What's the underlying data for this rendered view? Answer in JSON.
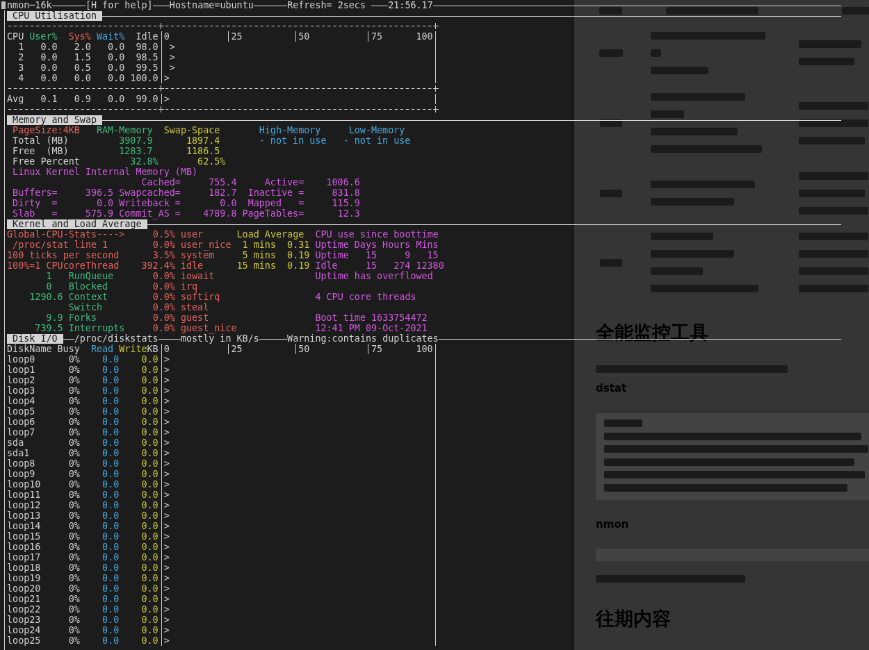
{
  "title_bar": {
    "items": [
      "nmon─16k",
      "[H for help]",
      "Hostname=ubuntu",
      "Refresh= 2secs",
      "21:56.17"
    ]
  },
  "cpu": {
    "title": "CPU Utilisation",
    "columns": [
      {
        "label": "CPU",
        "color": "#d0d0d0"
      },
      {
        "label": "User%",
        "color": "#3fb97d"
      },
      {
        "label": "Sys%",
        "color": "#e3625a"
      },
      {
        "label": "Wait%",
        "color": "#45a6dc"
      },
      {
        "label": "Idle",
        "color": "#d0d0d0"
      }
    ],
    "scale": [
      "0",
      "25",
      "50",
      "75",
      "100"
    ],
    "rows": [
      {
        "cpu": "1",
        "values": [
          "0.0",
          "2.0",
          "0.0",
          "98.0"
        ],
        "level": 0.02,
        "marker": ">"
      },
      {
        "cpu": "2",
        "values": [
          "0.0",
          "1.5",
          "0.0",
          "98.5"
        ],
        "level": 0.02,
        "marker": ">"
      },
      {
        "cpu": "3",
        "values": [
          "0.0",
          "0.5",
          "0.0",
          "99.5"
        ],
        "level": 0.02,
        "marker": ">"
      },
      {
        "cpu": "4",
        "values": [
          "0.0",
          "0.0",
          "0.0",
          "100.0"
        ],
        "level": 0,
        "marker": ">"
      }
    ],
    "average": {
      "cpu": "Avg",
      "values": [
        "0.1",
        "0.9",
        "0.0",
        "99.0"
      ],
      "level": 0,
      "marker": ">"
    }
  },
  "memory": {
    "title": "Memory and Swap",
    "page_size": "PageSize:4KB",
    "columns": [
      {
        "label": "RAM-Memory",
        "color": "#3fb97d"
      },
      {
        "label": "Swap-Space",
        "color": "#c9c83d"
      },
      {
        "label": "High-Memory",
        "color": "#45a6dc"
      },
      {
        "label": "Low-Memory",
        "color": "#45a6dc"
      }
    ],
    "rows": [
      {
        "label": "Total (MB)",
        "kind": "amount",
        "values": [
          "3907.9",
          "1897.4",
          "- not in use",
          "- not in use"
        ]
      },
      {
        "label": "Free  (MB)",
        "kind": "amount",
        "values": [
          "1283.7",
          "1186.5"
        ]
      },
      {
        "label": "Free Percent",
        "kind": "percent",
        "values": [
          "32.8%",
          "62.5%"
        ]
      }
    ],
    "kernel_title": "Linux Kernel Internal Memory (MB)",
    "kernel_rows": [
      [
        null,
        {
          "label": "Cached=",
          "value": "755.4"
        },
        {
          "label": "Active=",
          "value": "1006.6"
        }
      ],
      [
        {
          "label": "Buffers=",
          "value": "396.5"
        },
        {
          "label": "Swapcached=",
          "value": "182.7"
        },
        {
          "label": "Inactive =",
          "value": "831.8"
        }
      ],
      [
        {
          "label": "Dirty  =",
          "value": "0.0"
        },
        {
          "label": "Writeback =",
          "value": "0.0"
        },
        {
          "label": "Mapped   =",
          "value": "115.9"
        }
      ],
      [
        {
          "label": "Slab   =",
          "value": "575.9"
        },
        {
          "label": "Commit_AS =",
          "value": "4789.8"
        },
        {
          "label": "PageTables=",
          "value": "12.3"
        }
      ]
    ]
  },
  "kernel": {
    "title": "Kernel and Load Average",
    "notes": [
      "Global-CPU-Stats---->",
      " /proc/stat line 1",
      "100 ticks per second",
      "100%=1 CPUcoreThread"
    ],
    "counters": [
      {
        "kind": "count",
        "number": "1",
        "name": "RunQueue"
      },
      {
        "kind": "count",
        "number": "0",
        "name": "Blocked"
      },
      {
        "kind": "rate",
        "number": "1290.6",
        "name": "Context",
        "name_continued": "Switch"
      },
      {
        "kind": "rate",
        "number": "9.9",
        "name": "Forks"
      },
      {
        "kind": "rate",
        "number": "739.5",
        "name": "Interrupts"
      }
    ],
    "cpu_states": [
      {
        "percent": "0.5%",
        "label": "user"
      },
      {
        "percent": "0.0%",
        "label": "user_nice"
      },
      {
        "percent": "3.5%",
        "label": "system"
      },
      {
        "percent": "392.4%",
        "label": "idle"
      },
      {
        "percent": "0.0%",
        "label": "iowait"
      },
      {
        "percent": "0.0%",
        "label": "irq"
      },
      {
        "percent": "0.0%",
        "label": "softirq"
      },
      {
        "percent": "0.0%",
        "label": "steal"
      },
      {
        "percent": "0.0%",
        "label": "guest"
      },
      {
        "percent": "0.0%",
        "label": "guest_nice"
      }
    ],
    "load_average": {
      "title": "Load Average",
      "rows": [
        {
          "period": "1 mins",
          "value": "0.31"
        },
        {
          "period": "5 mins",
          "value": "0.19"
        },
        {
          "period": "15 mins",
          "value": "0.19"
        }
      ]
    },
    "boot": {
      "title": "CPU use since boottime",
      "uptime": {
        "columns": [
          "Uptime",
          "Days",
          "Hours",
          "Mins"
        ],
        "rows": [
          {
            "label": "Uptime",
            "values": [
              "15",
              "9",
              "15"
            ]
          },
          {
            "label": "Idle",
            "values": [
              "15",
              "274",
              "12380"
            ]
          }
        ]
      },
      "overflow_note": "Uptime has overflowed",
      "threads": "4 CPU core threads",
      "boot_time": "Boot time 1633754472",
      "boot_date": "12:41 PM 09-Oct-2021"
    }
  },
  "disk": {
    "title": "Disk I/O",
    "notes": [
      "/proc/diskstats",
      "mostly in KB/s",
      "Warning:contains duplicates"
    ],
    "columns": [
      {
        "label": "DiskName",
        "color": "#d0d0d0"
      },
      {
        "label": "Busy",
        "color": "#d0d0d0"
      },
      {
        "label": "Read",
        "color": "#45a6dc"
      },
      {
        "label": "Write",
        "color": "#c9c83d"
      }
    ],
    "unit": "KB",
    "scale": [
      "0",
      "25",
      "50",
      "75",
      "100"
    ],
    "rows": [
      {
        "name": "loop0",
        "values": [
          "0%",
          "0.0",
          "0.0"
        ],
        "level": 0,
        "marker": ">"
      },
      {
        "name": "loop1",
        "values": [
          "0%",
          "0.0",
          "0.0"
        ],
        "level": 0,
        "marker": ">"
      },
      {
        "name": "loop2",
        "values": [
          "0%",
          "0.0",
          "0.0"
        ],
        "level": 0,
        "marker": ">"
      },
      {
        "name": "loop3",
        "values": [
          "0%",
          "0.0",
          "0.0"
        ],
        "level": 0,
        "marker": ">"
      },
      {
        "name": "loop4",
        "values": [
          "0%",
          "0.0",
          "0.0"
        ],
        "level": 0,
        "marker": ">"
      },
      {
        "name": "loop5",
        "values": [
          "0%",
          "0.0",
          "0.0"
        ],
        "level": 0,
        "marker": ">"
      },
      {
        "name": "loop6",
        "values": [
          "0%",
          "0.0",
          "0.0"
        ],
        "level": 0,
        "marker": ">"
      },
      {
        "name": "loop7",
        "values": [
          "0%",
          "0.0",
          "0.0"
        ],
        "level": 0,
        "marker": ">"
      },
      {
        "name": "sda",
        "values": [
          "0%",
          "0.0",
          "0.0"
        ],
        "level": 0,
        "marker": ">"
      },
      {
        "name": "sda1",
        "values": [
          "0%",
          "0.0",
          "0.0"
        ],
        "level": 0,
        "marker": ">"
      },
      {
        "name": "loop8",
        "values": [
          "0%",
          "0.0",
          "0.0"
        ],
        "level": 0,
        "marker": ">"
      },
      {
        "name": "loop9",
        "values": [
          "0%",
          "0.0",
          "0.0"
        ],
        "level": 0,
        "marker": ">"
      },
      {
        "name": "loop10",
        "values": [
          "0%",
          "0.0",
          "0.0"
        ],
        "level": 0,
        "marker": ">"
      },
      {
        "name": "loop11",
        "values": [
          "0%",
          "0.0",
          "0.0"
        ],
        "level": 0,
        "marker": ">"
      },
      {
        "name": "loop12",
        "values": [
          "0%",
          "0.0",
          "0.0"
        ],
        "level": 0,
        "marker": ">"
      },
      {
        "name": "loop13",
        "values": [
          "0%",
          "0.0",
          "0.0"
        ],
        "level": 0,
        "marker": ">"
      },
      {
        "name": "loop14",
        "values": [
          "0%",
          "0.0",
          "0.0"
        ],
        "level": 0,
        "marker": ">"
      },
      {
        "name": "loop15",
        "values": [
          "0%",
          "0.0",
          "0.0"
        ],
        "level": 0,
        "marker": ">"
      },
      {
        "name": "loop16",
        "values": [
          "0%",
          "0.0",
          "0.0"
        ],
        "level": 0,
        "marker": ">"
      },
      {
        "name": "loop17",
        "values": [
          "0%",
          "0.0",
          "0.0"
        ],
        "level": 0,
        "marker": ">"
      },
      {
        "name": "loop18",
        "values": [
          "0%",
          "0.0",
          "0.0"
        ],
        "level": 0,
        "marker": ">"
      },
      {
        "name": "loop19",
        "values": [
          "0%",
          "0.0",
          "0.0"
        ],
        "level": 0,
        "marker": ">"
      },
      {
        "name": "loop20",
        "values": [
          "0%",
          "0.0",
          "0.0"
        ],
        "level": 0,
        "marker": ">"
      },
      {
        "name": "loop21",
        "values": [
          "0%",
          "0.0",
          "0.0"
        ],
        "level": 0,
        "marker": ">"
      },
      {
        "name": "loop22",
        "values": [
          "0%",
          "0.0",
          "0.0"
        ],
        "level": 0,
        "marker": ">"
      },
      {
        "name": "loop23",
        "values": [
          "0%",
          "0.0",
          "0.0"
        ],
        "level": 0,
        "marker": ">"
      },
      {
        "name": "loop24",
        "values": [
          "0%",
          "0.0",
          "0.0"
        ],
        "level": 0,
        "marker": ">"
      },
      {
        "name": "loop25",
        "values": [
          "0%",
          "0.0",
          "0.0"
        ],
        "level": 0,
        "marker": ">"
      }
    ]
  },
  "web_page": {
    "blocks": [
      {
        "kind": "blurred_table"
      },
      {
        "kind": "heading",
        "text": "全能监控工具"
      },
      {
        "kind": "blurred_text"
      },
      {
        "kind": "subheading",
        "text": "dstat"
      },
      {
        "kind": "code_block"
      },
      {
        "kind": "subheading",
        "text": "nmon"
      },
      {
        "kind": "empty_code_block"
      },
      {
        "kind": "blurred_text"
      },
      {
        "kind": "heading",
        "text": "往期内容"
      }
    ]
  }
}
